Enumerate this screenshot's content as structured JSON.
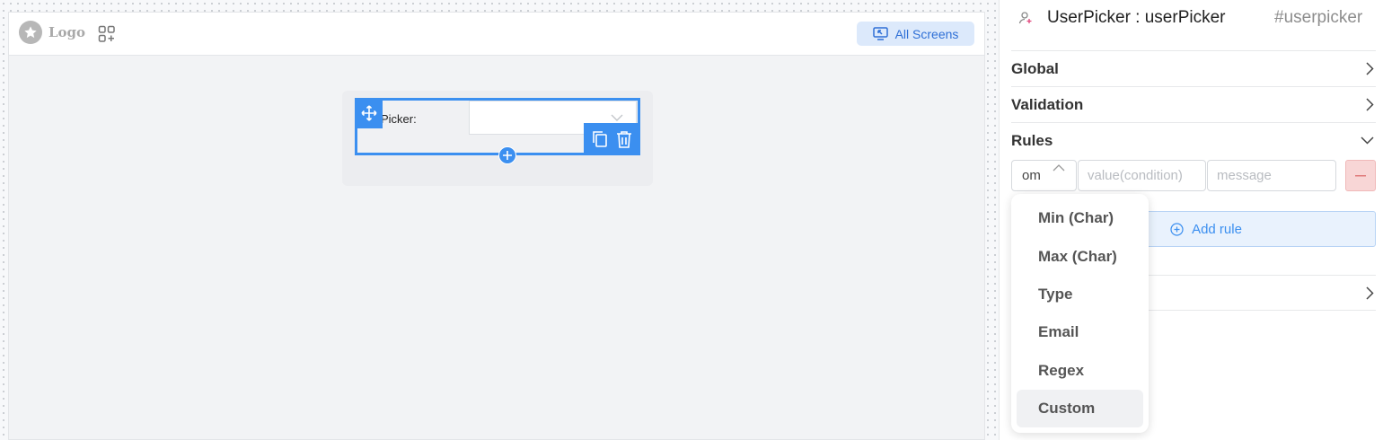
{
  "canvas": {
    "logo_text": "Logo",
    "all_screens_label": "All Screens",
    "widget": {
      "label": "Picker:"
    }
  },
  "panel": {
    "component_title": "UserPicker : userPicker",
    "component_id": "#userpicker",
    "sections": {
      "global": "Global",
      "validation": "Validation",
      "rules": "Rules"
    },
    "rule": {
      "type_value": "om",
      "value_placeholder": "value(condition)",
      "message_placeholder": "message"
    },
    "add_rule_label": "Add rule",
    "dropdown": {
      "options": [
        "Min (Char)",
        "Max (Char)",
        "Type",
        "Email",
        "Regex",
        "Custom"
      ],
      "selected": "Custom"
    }
  },
  "colors": {
    "accent": "#3b8ff0",
    "danger_bg": "#f8d6d6",
    "add_rule_bg": "#e9f2fd"
  }
}
